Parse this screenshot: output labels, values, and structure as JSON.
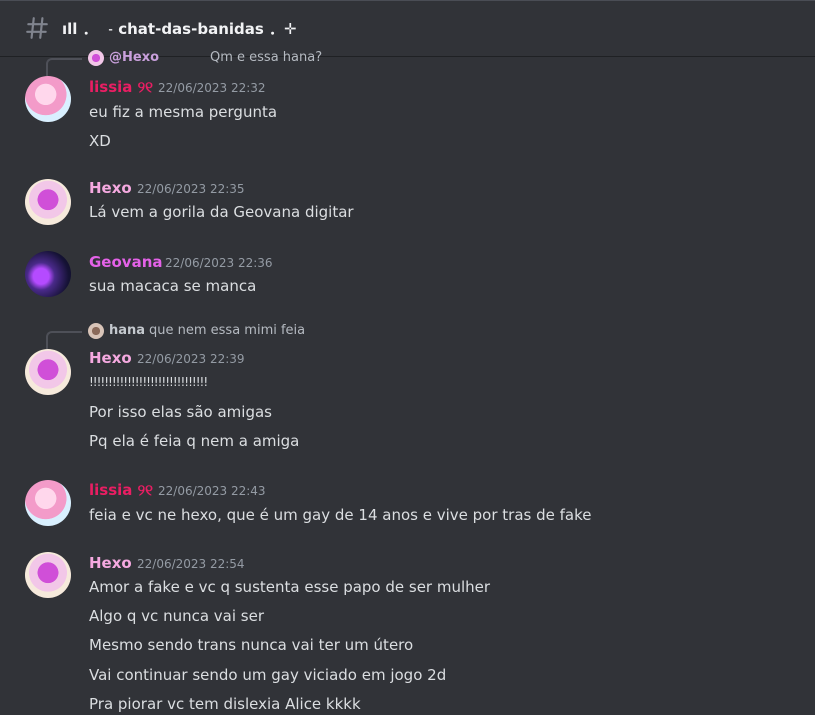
{
  "channel": {
    "name": "ıll ．  ˗ chat-das-banidas ．✛",
    "icon": "hash-icon"
  },
  "messages": [
    {
      "reply": {
        "author": "@Hexo",
        "text": "Qm e essa hana?"
      },
      "author": "lissia ୨୧",
      "timestamp": "22/06/2023 22:32",
      "lines": [
        "eu fiz a mesma pergunta",
        "XD"
      ]
    },
    {
      "author": "Hexo",
      "timestamp": "22/06/2023 22:35",
      "lines": [
        "Lá vem a gorila da Geovana digitar"
      ]
    },
    {
      "author": "Geovana",
      "timestamp": "22/06/2023 22:36",
      "lines": [
        "sua macaca se manca"
      ]
    },
    {
      "reply": {
        "author": "hana",
        "text": "que nem essa mimi feia"
      },
      "author": "Hexo",
      "timestamp": "22/06/2023 22:39",
      "lines": [
        "!!!!!!!!!!!!!!!!!!!!!!!!!!!!!!!",
        "Por isso elas são amigas",
        "Pq ela é feia q nem a amiga"
      ]
    },
    {
      "author": "lissia ୨୧",
      "timestamp": "22/06/2023 22:43",
      "lines": [
        "feia e vc ne hexo, que é um gay de 14 anos e vive por tras de fake"
      ]
    },
    {
      "author": "Hexo",
      "timestamp": "22/06/2023 22:54",
      "lines": [
        "Amor a fake e vc q sustenta esse papo de ser mulher",
        "Algo q vc nunca vai ser",
        "Mesmo sendo trans nunca vai ter um útero",
        "Vai continuar sendo um gay viciado em jogo 2d",
        "Pra piorar vc tem dislexia Alice kkkk"
      ]
    }
  ]
}
